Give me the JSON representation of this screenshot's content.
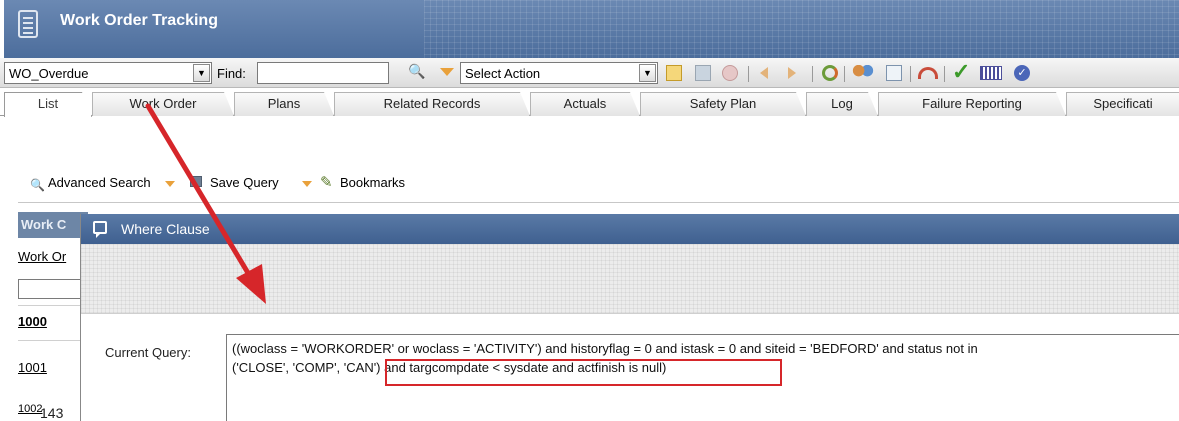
{
  "window": {
    "title": "Work Order Tracking"
  },
  "toolbar": {
    "query_select_value": "WO_Overdue",
    "find_label": "Find:",
    "find_value": "",
    "action_select_value": "Select Action"
  },
  "tabs": [
    {
      "label": "List",
      "active": true
    },
    {
      "label": "Work Order"
    },
    {
      "label": "Plans"
    },
    {
      "label": "Related Records"
    },
    {
      "label": "Actuals"
    },
    {
      "label": "Safety Plan"
    },
    {
      "label": "Log"
    },
    {
      "label": "Failure Reporting"
    },
    {
      "label": "Specificati"
    }
  ],
  "search": {
    "advanced_search": "Advanced Search",
    "save_query": "Save Query",
    "bookmarks": "Bookmarks"
  },
  "list": {
    "header": "Work C",
    "column_link": "Work Or",
    "rows": [
      "1000",
      "1001"
    ],
    "partial_row": "1002"
  },
  "dialog": {
    "title": "Where Clause",
    "current_query_label": "Current Query:",
    "current_query_line1": "((woclass = 'WORKORDER' or woclass = 'ACTIVITY') and historyflag = 0 and istask = 0 and siteid = 'BEDFORD' and status not in",
    "current_query_line2": "('CLOSE', 'COMP', 'CAN') and targcompdate < sysdate and actfinish is null)"
  },
  "page_number": "143",
  "colors": {
    "title_bar": "#4c6d9c",
    "dialog_title": "#3f6090",
    "annotation_red": "#d6262a"
  }
}
